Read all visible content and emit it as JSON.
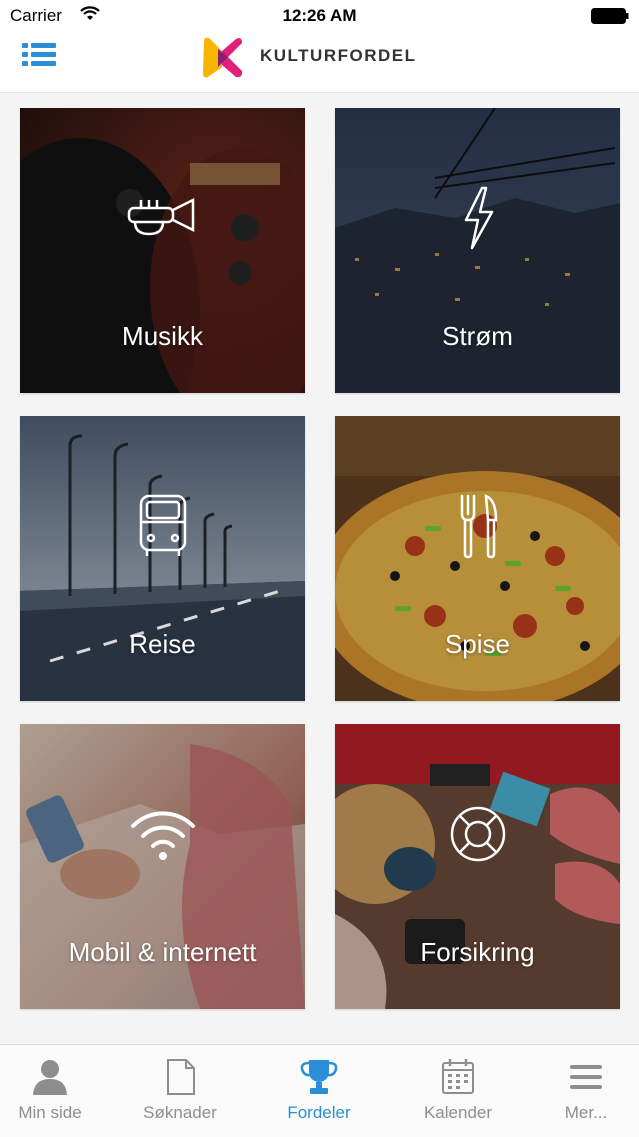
{
  "status_bar": {
    "carrier": "Carrier",
    "time": "12:26 AM"
  },
  "header": {
    "brand": "KULTURFORDEL"
  },
  "tiles": [
    {
      "label": "Musikk",
      "icon": "trumpet-icon"
    },
    {
      "label": "Strøm",
      "icon": "lightning-icon"
    },
    {
      "label": "Reise",
      "icon": "bus-icon"
    },
    {
      "label": "Spise",
      "icon": "fork-knife-icon"
    },
    {
      "label": "Mobil & internett",
      "icon": "wifi-icon"
    },
    {
      "label": "Forsikring",
      "icon": "lifebuoy-icon"
    }
  ],
  "tabbar": {
    "items": [
      {
        "label": "Min side",
        "icon": "person-icon"
      },
      {
        "label": "Søknader",
        "icon": "document-icon"
      },
      {
        "label": "Fordeler",
        "icon": "trophy-icon",
        "active": true
      },
      {
        "label": "Kalender",
        "icon": "calendar-icon"
      },
      {
        "label": "Mer...",
        "icon": "menu-icon"
      }
    ]
  },
  "colors": {
    "accent": "#2a8fd8",
    "inactive": "#8e8e8e",
    "logo_pink": "#e0207a",
    "logo_yellow": "#f7b500"
  }
}
